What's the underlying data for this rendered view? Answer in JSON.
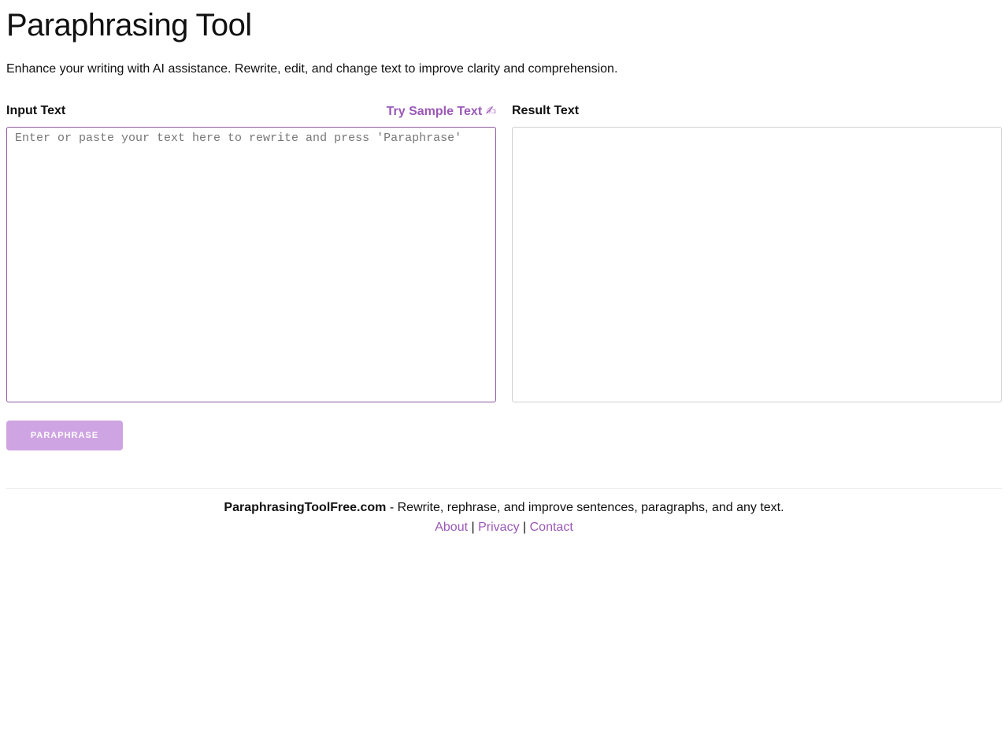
{
  "header": {
    "title": "Paraphrasing Tool",
    "subtitle": "Enhance your writing with AI assistance. Rewrite, edit, and change text to improve clarity and comprehension."
  },
  "input_panel": {
    "label": "Input Text",
    "sample_link_label": "Try Sample Text",
    "sample_link_icon": "✍",
    "placeholder": "Enter or paste your text here to rewrite and press 'Paraphrase'",
    "value": ""
  },
  "result_panel": {
    "label": "Result Text",
    "value": ""
  },
  "action": {
    "paraphrase_label": "PARAPHRASE"
  },
  "footer": {
    "brand": "ParaphrasingToolFree.com",
    "tagline": " - Rewrite, rephrase, and improve sentences, paragraphs, and any text.",
    "links": {
      "about": "About",
      "privacy": "Privacy",
      "contact": "Contact",
      "separator": "|"
    }
  },
  "colors": {
    "accent": "#9b59b6",
    "button_bg": "#cfa4e3",
    "input_border": "#8e5a9e",
    "result_border": "#cfcfcf"
  }
}
